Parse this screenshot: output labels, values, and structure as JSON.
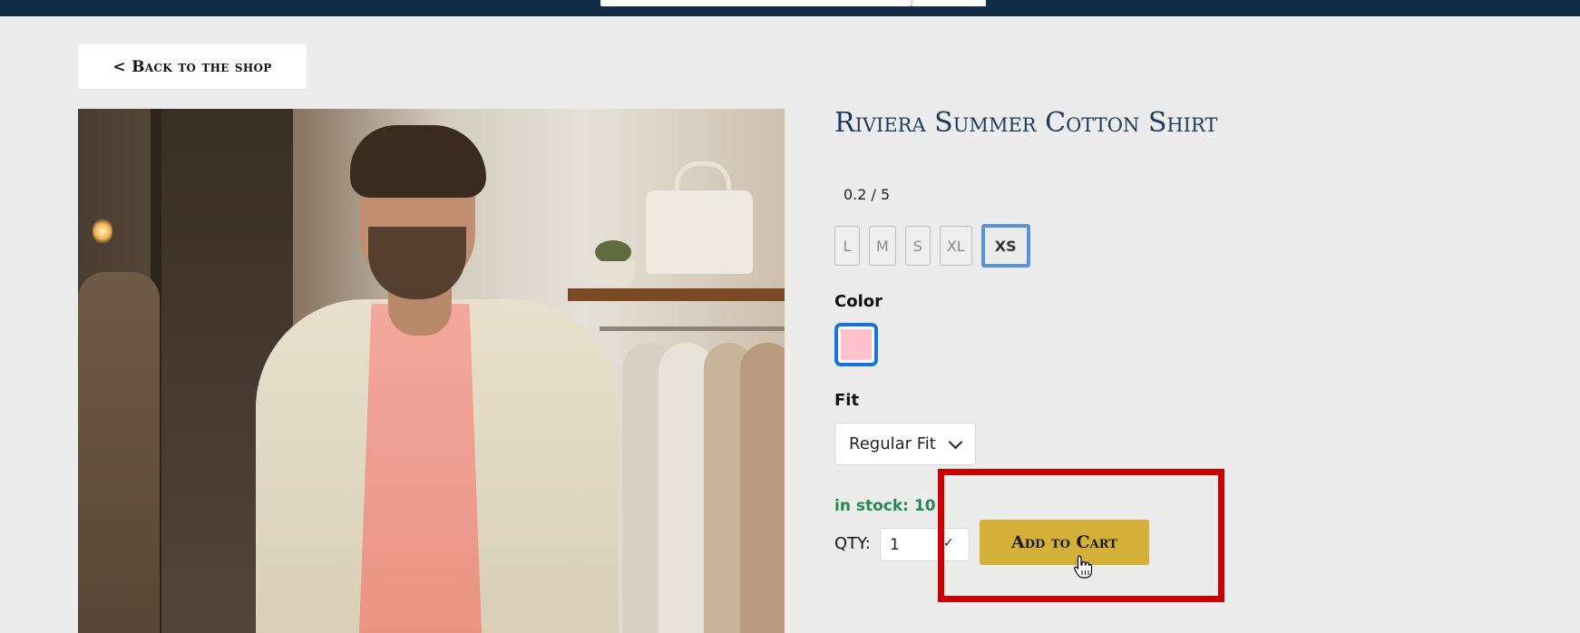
{
  "nav": {
    "back_label": "< Back to the shop"
  },
  "product": {
    "title": "Riviera Summer Cotton Shirt",
    "rating": "0.2 / 5",
    "sizes": [
      "L",
      "M",
      "S",
      "XL",
      "XS"
    ],
    "selected_size": "XS",
    "color_label": "Color",
    "selected_color": "#ffc0cb",
    "fit_label": "Fit",
    "fit_value": "Regular Fit",
    "stock_text": "in stock: 10",
    "qty_label": "QTY:",
    "qty_value": "1",
    "add_to_cart_label": "Add to Cart"
  },
  "colors": {
    "topbar": "#112a45",
    "title": "#1c3a5e",
    "accent_button": "#d5b038",
    "stock_green": "#238a4f",
    "highlight_red": "#cc0000",
    "selected_border": "#5b93d8"
  }
}
